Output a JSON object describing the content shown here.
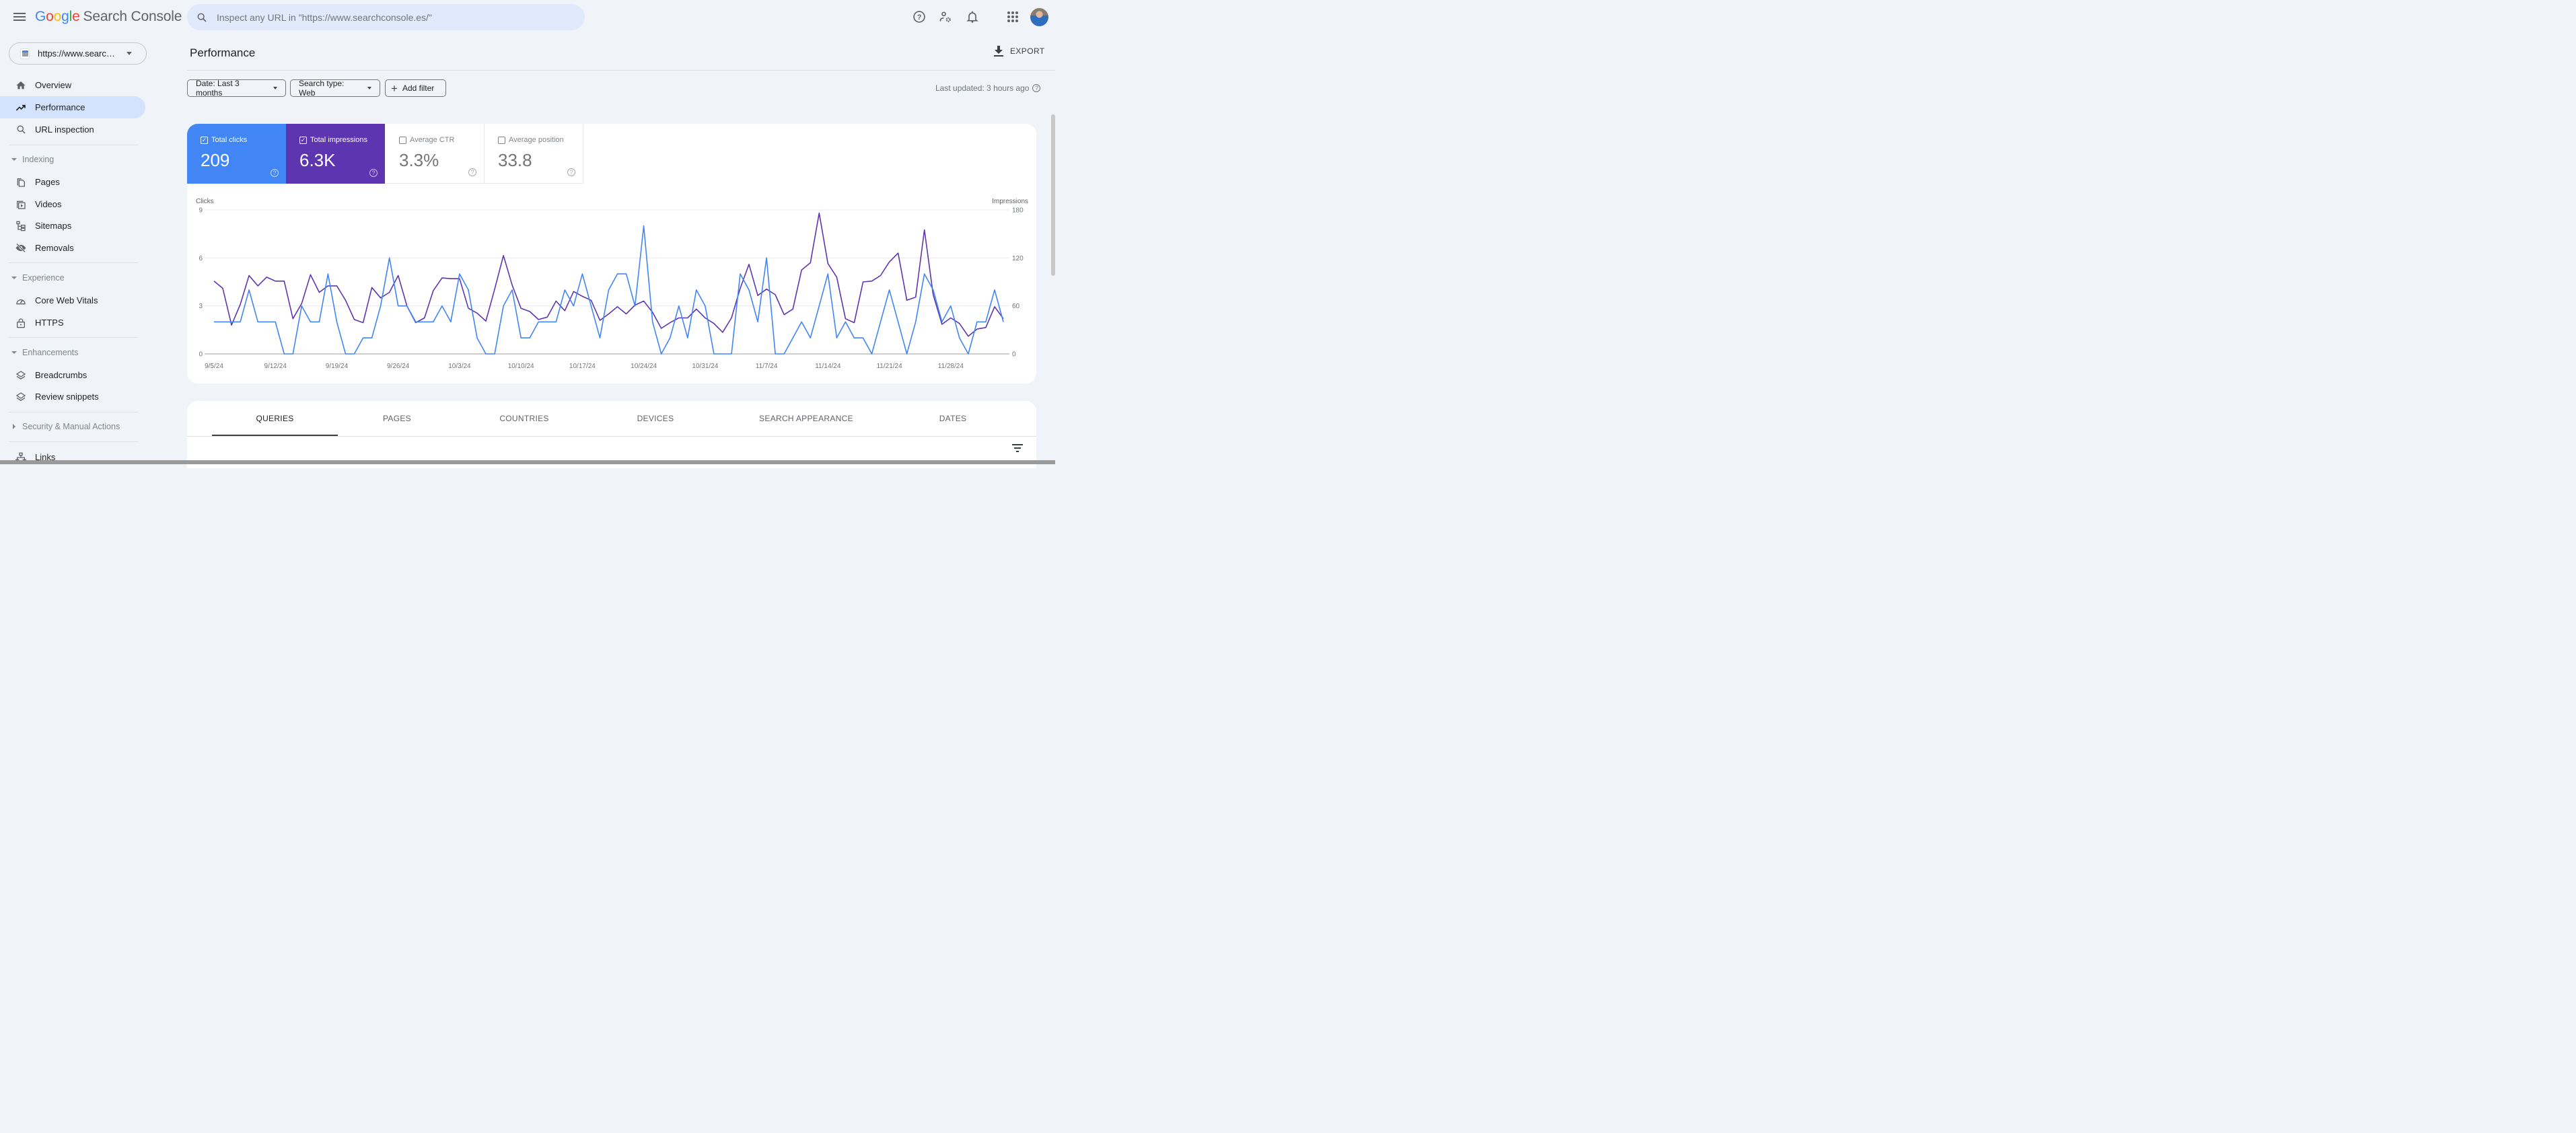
{
  "app": {
    "brand_letters": [
      "G",
      "o",
      "o",
      "g",
      "l",
      "e"
    ],
    "product": "Search Console"
  },
  "topbar": {
    "search_placeholder": "Inspect any URL in \"https://www.searchconsole.es/\"",
    "icons": [
      "help-icon",
      "manage-users-icon",
      "notifications-icon",
      "apps-grid-icon",
      "account-avatar"
    ]
  },
  "sidebar": {
    "property": "https://www.searchconsole.es/",
    "property_display": "https://www.search...",
    "items_top": [
      {
        "label": "Overview",
        "icon": "home-icon",
        "active": false
      },
      {
        "label": "Performance",
        "icon": "trending-up-icon",
        "active": true
      },
      {
        "label": "URL inspection",
        "icon": "search-icon",
        "active": false
      }
    ],
    "sections": [
      {
        "title": "Indexing",
        "expanded": true,
        "items": [
          {
            "label": "Pages",
            "icon": "pages-icon"
          },
          {
            "label": "Videos",
            "icon": "videos-icon"
          },
          {
            "label": "Sitemaps",
            "icon": "sitemap-icon"
          },
          {
            "label": "Removals",
            "icon": "eye-off-icon"
          }
        ]
      },
      {
        "title": "Experience",
        "expanded": true,
        "items": [
          {
            "label": "Core Web Vitals",
            "icon": "speedometer-icon"
          },
          {
            "label": "HTTPS",
            "icon": "lock-icon"
          }
        ]
      },
      {
        "title": "Enhancements",
        "expanded": true,
        "items": [
          {
            "label": "Breadcrumbs",
            "icon": "layers-icon"
          },
          {
            "label": "Review snippets",
            "icon": "layers-icon"
          }
        ]
      },
      {
        "title": "Security & Manual Actions",
        "expanded": false,
        "items": []
      }
    ],
    "items_bottom": [
      {
        "label": "Links",
        "icon": "links-icon"
      }
    ]
  },
  "header": {
    "title": "Performance",
    "export_label": "EXPORT",
    "filters": {
      "date": "Date: Last 3 months",
      "search_type": "Search type: Web",
      "add_filter": "Add filter"
    },
    "last_updated": "Last updated: 3 hours ago"
  },
  "metrics": [
    {
      "label": "Total clicks",
      "value": "209",
      "checked": true,
      "color": "#4285f4"
    },
    {
      "label": "Total impressions",
      "value": "6.3K",
      "checked": true,
      "color": "#5e35b1"
    },
    {
      "label": "Average CTR",
      "value": "3.3%",
      "checked": false
    },
    {
      "label": "Average position",
      "value": "33.8",
      "checked": false
    }
  ],
  "tabs": {
    "items": [
      "QUERIES",
      "PAGES",
      "COUNTRIES",
      "DEVICES",
      "SEARCH APPEARANCE",
      "DATES"
    ],
    "active": "QUERIES"
  },
  "chart_data": {
    "type": "line",
    "title": "",
    "x_start": "9/5/24",
    "x_end": "12/4/24",
    "x_tick_labels": [
      "9/5/24",
      "9/12/24",
      "9/19/24",
      "9/26/24",
      "10/3/24",
      "10/10/24",
      "10/17/24",
      "10/24/24",
      "10/31/24",
      "11/7/24",
      "11/14/24",
      "11/21/24",
      "11/28/24"
    ],
    "ylabel_left": "Clicks",
    "ylabel_right": "Impressions",
    "ylim_left": [
      0,
      9
    ],
    "yticks_left": [
      0,
      3,
      6,
      9
    ],
    "ylim_right": [
      0,
      180
    ],
    "yticks_right": [
      0,
      60,
      120,
      180
    ],
    "grid": true,
    "series": [
      {
        "name": "Clicks",
        "axis": "left",
        "color": "#4285f4",
        "values": [
          2,
          2,
          2,
          2,
          4,
          2,
          2,
          2,
          0,
          0,
          3,
          2,
          2,
          5,
          2,
          0,
          0,
          1,
          1,
          3,
          6,
          3,
          3,
          2,
          2,
          2,
          3,
          2,
          5,
          4,
          1,
          0,
          0,
          3,
          4,
          1,
          1,
          2,
          2,
          2,
          4,
          3,
          5,
          3,
          1,
          4,
          5,
          5,
          3,
          8,
          2,
          0,
          1,
          3,
          1,
          4,
          3,
          0,
          0,
          0,
          5,
          4,
          2,
          6,
          0,
          0,
          1,
          2,
          1,
          3,
          5,
          1,
          2,
          1,
          1,
          0,
          2,
          4,
          2,
          0,
          2,
          5,
          4,
          2,
          3,
          1,
          0,
          2,
          2,
          4,
          2
        ]
      },
      {
        "name": "Impressions",
        "axis": "right",
        "color": "#5e35b1",
        "values": [
          91,
          82,
          36,
          62,
          98,
          85,
          96,
          91,
          91,
          44,
          63,
          99,
          77,
          85,
          85,
          67,
          43,
          39,
          83,
          70,
          77,
          98,
          60,
          39,
          45,
          79,
          95,
          94,
          94,
          57,
          51,
          41,
          81,
          123,
          86,
          57,
          53,
          43,
          46,
          66,
          54,
          78,
          72,
          67,
          42,
          50,
          59,
          50,
          61,
          66,
          52,
          32,
          39,
          45,
          45,
          56,
          45,
          38,
          27,
          45,
          82,
          112,
          73,
          81,
          74,
          49,
          56,
          105,
          114,
          176,
          113,
          96,
          44,
          39,
          90,
          91,
          98,
          115,
          126,
          67,
          71,
          155,
          74,
          37,
          45,
          38,
          22,
          31,
          33,
          59,
          44
        ]
      }
    ]
  }
}
